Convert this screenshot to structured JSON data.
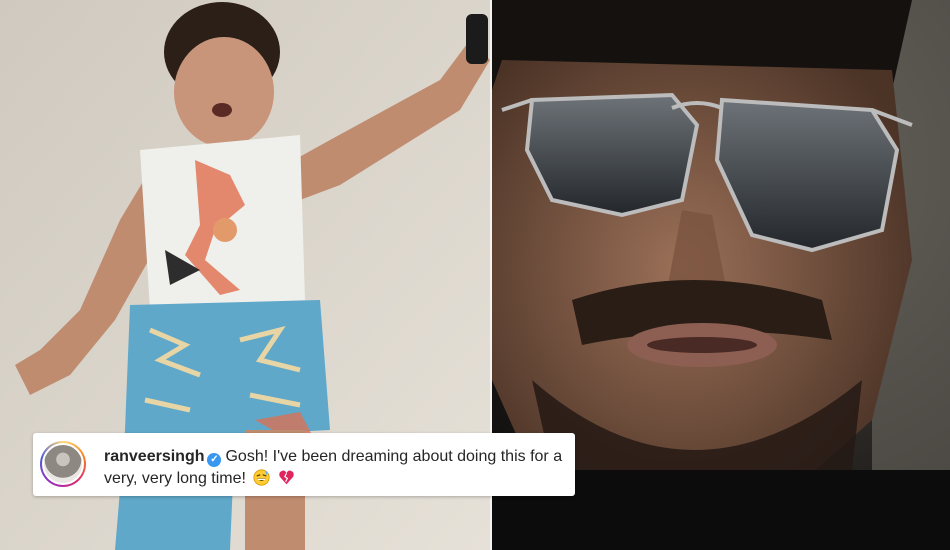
{
  "left_photo": {
    "icon": "child-dancing-photo",
    "colors": {
      "wall": "#d9d3c9",
      "shirt": "#eeeeec",
      "shorts": "#5fa8c9"
    }
  },
  "right_photo": {
    "icon": "man-in-aviator-sunglasses-photo",
    "colors": {
      "background": "#1a1816",
      "skin": "#8a6248",
      "lenses": "#3a3f45"
    }
  },
  "comment": {
    "username": "ranveersingh",
    "verified_icon": "verified-badge-icon",
    "text": "Gosh! I've been dreaming about doing this for a very, very long time!",
    "emojis": [
      "grinning-sweat-emoji",
      "broken-heart-emoji"
    ]
  }
}
